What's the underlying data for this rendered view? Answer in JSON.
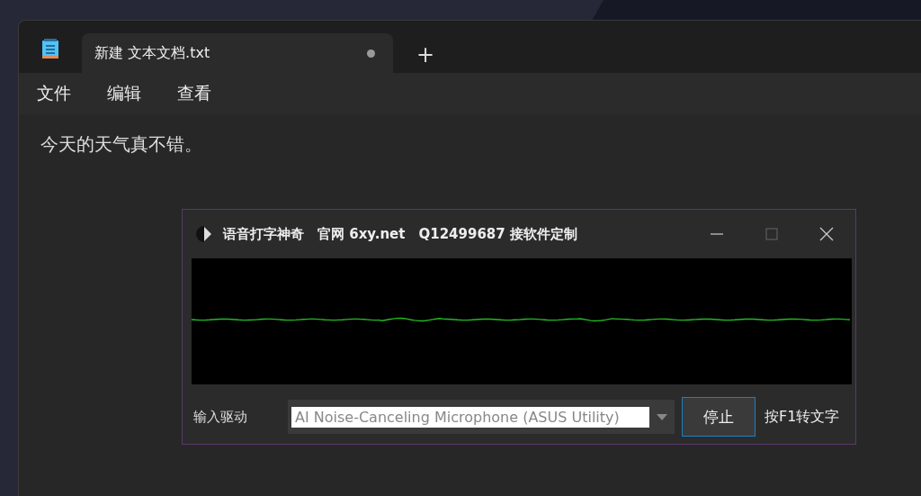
{
  "editor": {
    "tabs": [
      {
        "label": "新建 文本文档.txt",
        "selected": true,
        "modified": true
      }
    ],
    "new_tab": "+",
    "menu": [
      "文件",
      "编辑",
      "查看"
    ],
    "content": "今天的天气真不错。"
  },
  "dialog": {
    "title": "语音打字神奇　官网 6xy.net　Q12499687 接软件定制",
    "input_label": "输入驱动",
    "device": "AI Noise-Canceling Microphone (ASUS Utility)",
    "stop_button": "停止",
    "hint": "按F1转文字"
  }
}
